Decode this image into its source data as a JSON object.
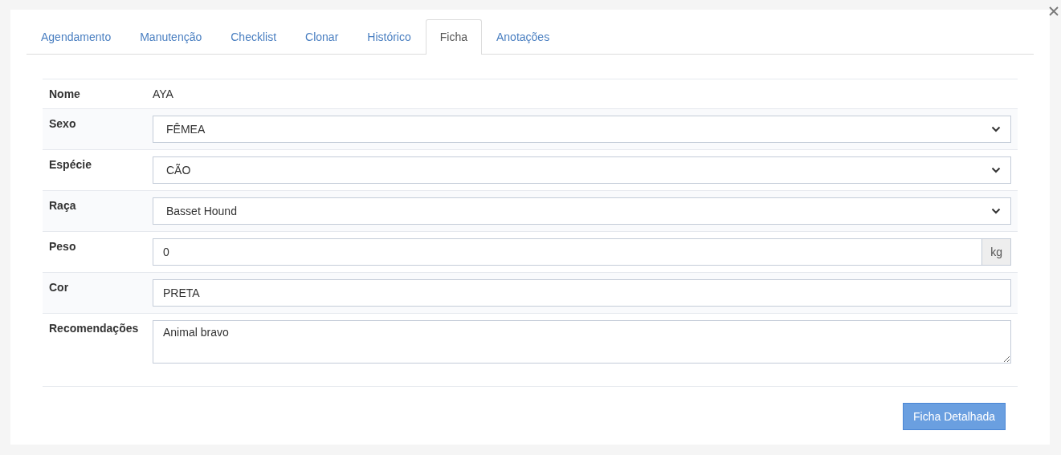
{
  "tabs": [
    {
      "label": "Agendamento",
      "selected": false
    },
    {
      "label": "Manutenção",
      "selected": false
    },
    {
      "label": "Checklist",
      "selected": false
    },
    {
      "label": "Clonar",
      "selected": false
    },
    {
      "label": "Histórico",
      "selected": false
    },
    {
      "label": "Ficha",
      "selected": true
    },
    {
      "label": "Anotações",
      "selected": false
    }
  ],
  "form": {
    "rows": [
      {
        "label": "Nome",
        "kind": "text",
        "value": "AYA"
      },
      {
        "label": "Sexo",
        "kind": "select",
        "value": "FÊMEA"
      },
      {
        "label": "Espécie",
        "kind": "select",
        "value": "CÃO"
      },
      {
        "label": "Raça",
        "kind": "select",
        "value": "Basset Hound"
      },
      {
        "label": "Peso",
        "kind": "input",
        "value": "0",
        "unit": "kg"
      },
      {
        "label": "Cor",
        "kind": "input",
        "value": "PRETA"
      },
      {
        "label": "Recomendações",
        "kind": "textarea",
        "value": "Animal bravo"
      }
    ]
  },
  "buttons": [
    {
      "label": "Ficha Detalhada"
    }
  ]
}
